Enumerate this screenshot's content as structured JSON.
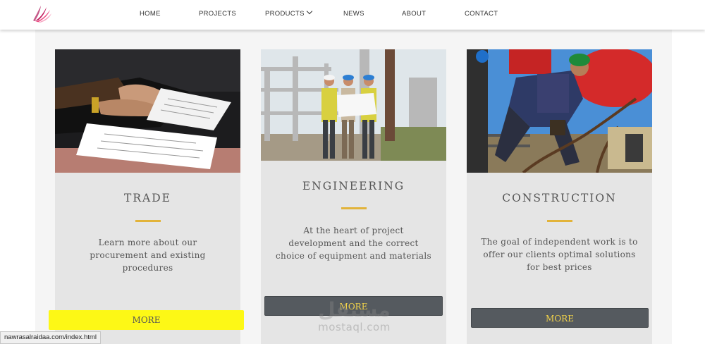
{
  "header": {
    "nav": [
      {
        "label": "HOME"
      },
      {
        "label": "PROJECTS"
      },
      {
        "label": "PRODUCTS"
      },
      {
        "label": "NEWS"
      },
      {
        "label": "ABOUT"
      },
      {
        "label": "CONTACT"
      }
    ]
  },
  "cards": [
    {
      "title": "TRADE",
      "description": "Learn more about our procurement and existing procedures",
      "button": "MORE",
      "image": "document-signing-photo"
    },
    {
      "title": "ENGINEERING",
      "description": "At the heart of project development and the correct choice of equipment and materials",
      "button": "MORE",
      "image": "engineers-on-site-photo"
    },
    {
      "title": "CONSTRUCTION",
      "description": "The goal of independent work is to offer our clients optimal solutions for best prices",
      "button": "MORE",
      "image": "workers-with-chains-photo"
    }
  ],
  "status_bar": {
    "url": "nawrasalraidaa.com/index.html"
  },
  "watermark": {
    "arabic": "مستقل",
    "latin": "mostaql.com"
  },
  "colors": {
    "accent": "#e2b33a",
    "button_bg": "#555a5f",
    "button_text": "#f2d34a",
    "highlight": "#fdf816"
  }
}
